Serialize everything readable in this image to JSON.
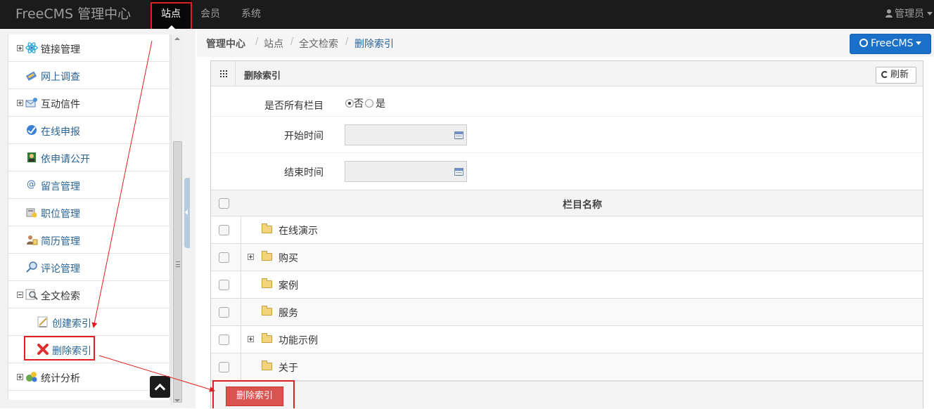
{
  "header": {
    "brand": "FreeCMS 管理中心",
    "nav": [
      {
        "label": "站点",
        "active": true
      },
      {
        "label": "会员",
        "active": false
      },
      {
        "label": "系统",
        "active": false
      }
    ],
    "user": "管理员"
  },
  "sidebar": {
    "items": [
      {
        "label": "链接管理",
        "expander": "plus",
        "icon": "atom-icon"
      },
      {
        "label": "网上调查",
        "expander": "none",
        "icon": "survey-icon"
      },
      {
        "label": "互动信件",
        "expander": "plus",
        "icon": "letter-icon"
      },
      {
        "label": "在线申报",
        "expander": "none",
        "icon": "online-apply-icon"
      },
      {
        "label": "依申请公开",
        "expander": "none",
        "icon": "disclosure-icon"
      },
      {
        "label": "留言管理",
        "expander": "none",
        "icon": "at-icon"
      },
      {
        "label": "职位管理",
        "expander": "none",
        "icon": "position-icon"
      },
      {
        "label": "简历管理",
        "expander": "none",
        "icon": "resume-icon"
      },
      {
        "label": "评论管理",
        "expander": "none",
        "icon": "comment-icon"
      },
      {
        "label": "全文检索",
        "expander": "minus",
        "icon": "fulltext-search-icon"
      },
      {
        "label": "创建索引",
        "expander": "child",
        "icon": "create-index-icon"
      },
      {
        "label": "删除索引",
        "expander": "child",
        "icon": "delete-index-icon"
      },
      {
        "label": "统计分析",
        "expander": "plus",
        "icon": "statistics-icon"
      }
    ]
  },
  "breadcrumb": {
    "items": [
      "管理中心",
      "站点",
      "全文检索",
      "删除索引"
    ],
    "separator": "/"
  },
  "site_button": "FreeCMS",
  "panel": {
    "title": "删除索引",
    "refresh": "刷新",
    "all_columns_label": "是否所有栏目",
    "radio_no": "否",
    "radio_yes": "是",
    "selected": "否",
    "start_time_label": "开始时间",
    "end_time_label": "结束时间",
    "start_time_value": "",
    "end_time_value": "",
    "column_header": "栏目名称",
    "rows": [
      {
        "name": "在线演示",
        "expandable": false
      },
      {
        "name": "购买",
        "expandable": true
      },
      {
        "name": "案例",
        "expandable": false
      },
      {
        "name": "服务",
        "expandable": false
      },
      {
        "name": "功能示例",
        "expandable": true
      },
      {
        "name": "关于",
        "expandable": false
      }
    ],
    "delete_button": "删除索引"
  },
  "colors": {
    "topbar": "#1b1b1b",
    "link": "#2a6496",
    "primary": "#1a6fc9",
    "danger": "#d9534f",
    "annotation": "#e02020"
  }
}
